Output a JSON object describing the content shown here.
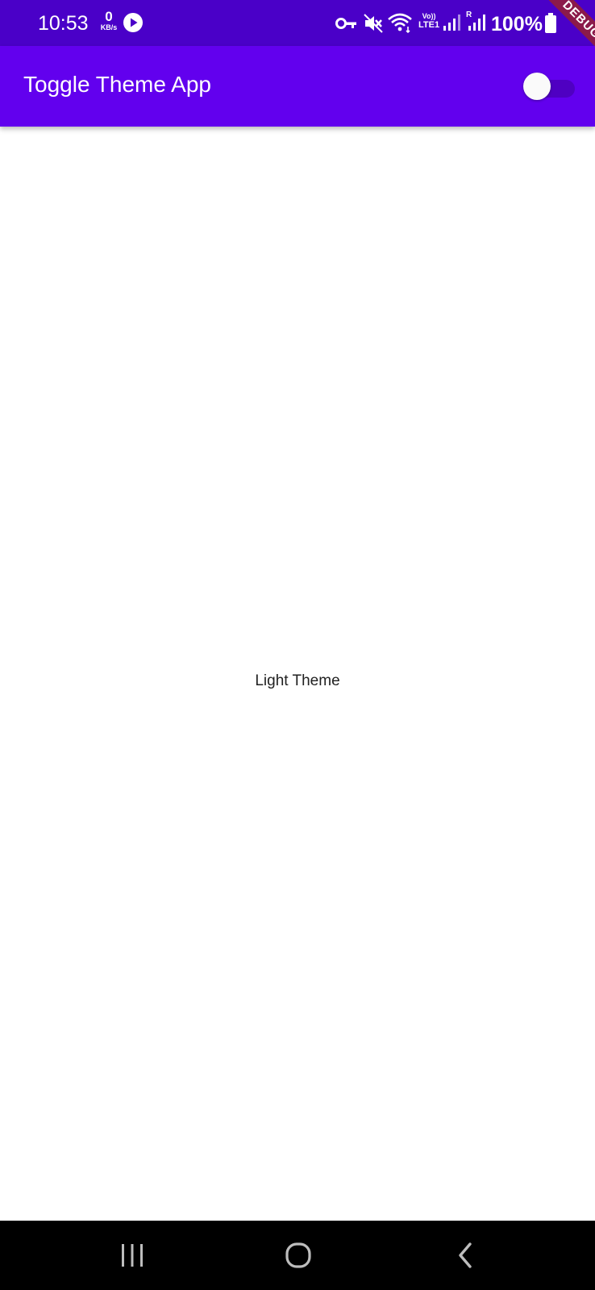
{
  "status_bar": {
    "time": "10:53",
    "net_speed_value": "0",
    "net_speed_unit": "KB/s",
    "volte_label": "Vo))\nLTE1",
    "roaming_label": "R",
    "battery": "100%",
    "icons": [
      "play-icon",
      "vpn-key-icon",
      "mute-icon",
      "wifi-icon",
      "signal-icon",
      "signal-roaming-icon",
      "battery-icon"
    ]
  },
  "app_bar": {
    "title": "Toggle Theme App",
    "theme_switch": {
      "on": false
    }
  },
  "debug_banner": {
    "label": "DEBUG"
  },
  "body": {
    "theme_label": "Light Theme"
  },
  "nav_bar": {
    "buttons": [
      "recent-apps",
      "home",
      "back"
    ]
  },
  "colors": {
    "status_bar": "#4a00c8",
    "app_bar": "#6200ee",
    "background": "#ffffff",
    "nav_bar": "#000000",
    "debug_banner": "#8b1a4a"
  }
}
